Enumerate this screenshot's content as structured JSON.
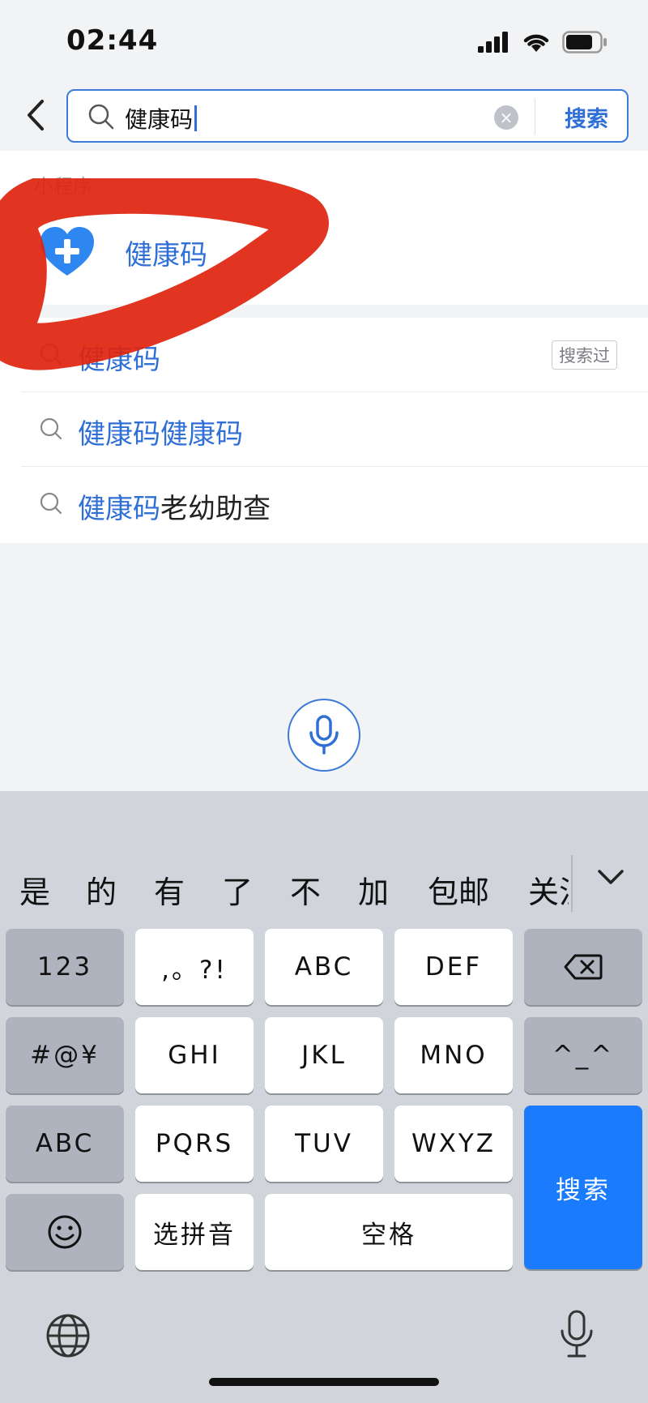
{
  "status_bar": {
    "time": "02:44"
  },
  "search": {
    "query": "健康码",
    "search_button": "搜索"
  },
  "mini_program": {
    "section_label": "小程序",
    "item_name": "健康码"
  },
  "suggestions": [
    {
      "highlight": "健康码",
      "rest": "",
      "tag": "搜索过"
    },
    {
      "highlight": "健康码健康码",
      "rest": "",
      "tag": ""
    },
    {
      "highlight": "健康码",
      "rest": "老幼助查",
      "tag": ""
    }
  ],
  "keyboard": {
    "candidates": [
      "是",
      "的",
      "有",
      "了",
      "不",
      "加",
      "包邮",
      "关注"
    ],
    "keys": {
      "num": "123",
      "punct": ",。?!",
      "abc2": "ABC",
      "def": "DEF",
      "sym": "#@¥",
      "ghi": "GHI",
      "jkl": "JKL",
      "mno": "MNO",
      "emoticon": "^_^",
      "abc_switch": "ABC",
      "pqrs": "PQRS",
      "tuv": "TUV",
      "wxyz": "WXYZ",
      "search": "搜索",
      "pinyin": "选拼音",
      "space": "空格"
    }
  },
  "colors": {
    "accent": "#2f6fd6",
    "keyboard_primary": "#1a7bff",
    "marker_red": "#e0240e",
    "mini_logo": "#2e86f0"
  }
}
